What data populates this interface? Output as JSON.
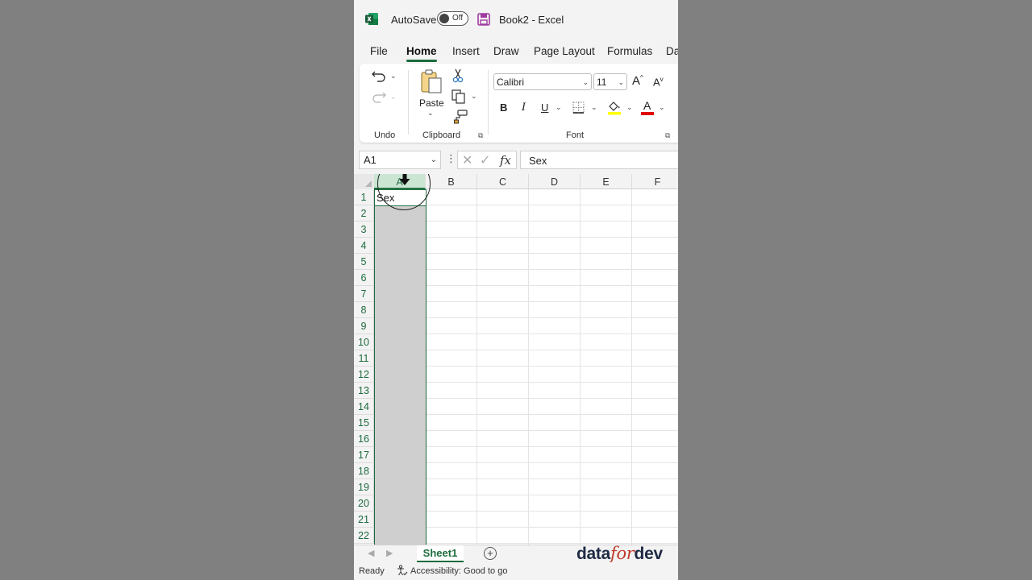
{
  "titlebar": {
    "autosave_label": "AutoSave",
    "autosave_state": "Off",
    "document_title": "Book2  -  Excel"
  },
  "tabs": [
    {
      "label": "File"
    },
    {
      "label": "Home",
      "active": true
    },
    {
      "label": "Insert"
    },
    {
      "label": "Draw"
    },
    {
      "label": "Page Layout"
    },
    {
      "label": "Formulas"
    },
    {
      "label": "Da"
    }
  ],
  "ribbon": {
    "undo_group": "Undo",
    "clipboard_group": "Clipboard",
    "paste_label": "Paste",
    "font_group": "Font",
    "font_name": "Calibri",
    "font_size": "11",
    "bold": "B",
    "italic": "I",
    "underline": "U",
    "grow_font": "A",
    "shrink_font": "A",
    "font_color_letter": "A"
  },
  "formula_bar": {
    "name_box": "A1",
    "cancel": "✕",
    "enter": "✓",
    "fx": "fx",
    "formula": "Sex"
  },
  "grid": {
    "columns": [
      "A",
      "B",
      "C",
      "D",
      "E",
      "F"
    ],
    "selected_column": "A",
    "rows": [
      "1",
      "2",
      "3",
      "4",
      "5",
      "6",
      "7",
      "8",
      "9",
      "10",
      "11",
      "12",
      "13",
      "14",
      "15",
      "16",
      "17",
      "18",
      "19",
      "20",
      "21",
      "22"
    ],
    "cell_A1": "Sex"
  },
  "sheets": {
    "active": "Sheet1",
    "add": "+"
  },
  "brand": {
    "left": "data",
    "mid": "for",
    "right": "dev"
  },
  "status": {
    "ready": "Ready",
    "accessibility": "Accessibility: Good to go"
  },
  "colors": {
    "excel_green": "#1d6b3e",
    "highlight_yellow": "#ffff00",
    "font_red": "#e00000",
    "save_purple": "#a03aa0"
  }
}
